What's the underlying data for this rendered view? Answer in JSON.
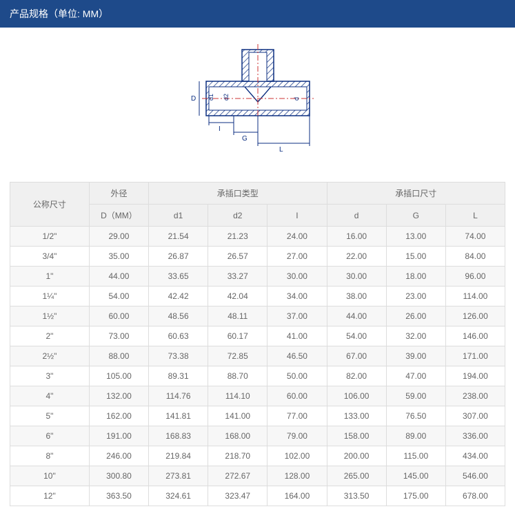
{
  "header": {
    "title": "产品规格（单位: MM）"
  },
  "diagram": {
    "labels": {
      "D": "D",
      "d1": "d1",
      "d2": "d2",
      "d": "d",
      "I": "I",
      "G": "G",
      "L": "L"
    }
  },
  "table": {
    "head1": {
      "nominal": "公称尺寸",
      "outer": "外径",
      "socket_type": "承插口类型",
      "socket_dim": "承插口尺寸"
    },
    "head2": {
      "D": "D（MM）",
      "d1": "d1",
      "d2": "d2",
      "I": "I",
      "d": "d",
      "G": "G",
      "L": "L"
    },
    "rows": [
      {
        "nominal": "1/2\"",
        "D": "29.00",
        "d1": "21.54",
        "d2": "21.23",
        "I": "24.00",
        "d": "16.00",
        "G": "13.00",
        "L": "74.00"
      },
      {
        "nominal": "3/4\"",
        "D": "35.00",
        "d1": "26.87",
        "d2": "26.57",
        "I": "27.00",
        "d": "22.00",
        "G": "15.00",
        "L": "84.00"
      },
      {
        "nominal": "1\"",
        "D": "44.00",
        "d1": "33.65",
        "d2": "33.27",
        "I": "30.00",
        "d": "30.00",
        "G": "18.00",
        "L": "96.00"
      },
      {
        "nominal": "1¼\"",
        "D": "54.00",
        "d1": "42.42",
        "d2": "42.04",
        "I": "34.00",
        "d": "38.00",
        "G": "23.00",
        "L": "114.00"
      },
      {
        "nominal": "1½\"",
        "D": "60.00",
        "d1": "48.56",
        "d2": "48.11",
        "I": "37.00",
        "d": "44.00",
        "G": "26.00",
        "L": "126.00"
      },
      {
        "nominal": "2\"",
        "D": "73.00",
        "d1": "60.63",
        "d2": "60.17",
        "I": "41.00",
        "d": "54.00",
        "G": "32.00",
        "L": "146.00"
      },
      {
        "nominal": "2½\"",
        "D": "88.00",
        "d1": "73.38",
        "d2": "72.85",
        "I": "46.50",
        "d": "67.00",
        "G": "39.00",
        "L": "171.00"
      },
      {
        "nominal": "3\"",
        "D": "105.00",
        "d1": "89.31",
        "d2": "88.70",
        "I": "50.00",
        "d": "82.00",
        "G": "47.00",
        "L": "194.00"
      },
      {
        "nominal": "4\"",
        "D": "132.00",
        "d1": "114.76",
        "d2": "114.10",
        "I": "60.00",
        "d": "106.00",
        "G": "59.00",
        "L": "238.00"
      },
      {
        "nominal": "5\"",
        "D": "162.00",
        "d1": "141.81",
        "d2": "141.00",
        "I": "77.00",
        "d": "133.00",
        "G": "76.50",
        "L": "307.00"
      },
      {
        "nominal": "6\"",
        "D": "191.00",
        "d1": "168.83",
        "d2": "168.00",
        "I": "79.00",
        "d": "158.00",
        "G": "89.00",
        "L": "336.00"
      },
      {
        "nominal": "8\"",
        "D": "246.00",
        "d1": "219.84",
        "d2": "218.70",
        "I": "102.00",
        "d": "200.00",
        "G": "115.00",
        "L": "434.00"
      },
      {
        "nominal": "10\"",
        "D": "300.80",
        "d1": "273.81",
        "d2": "272.67",
        "I": "128.00",
        "d": "265.00",
        "G": "145.00",
        "L": "546.00"
      },
      {
        "nominal": "12\"",
        "D": "363.50",
        "d1": "324.61",
        "d2": "323.47",
        "I": "164.00",
        "d": "313.50",
        "G": "175.00",
        "L": "678.00"
      }
    ]
  }
}
